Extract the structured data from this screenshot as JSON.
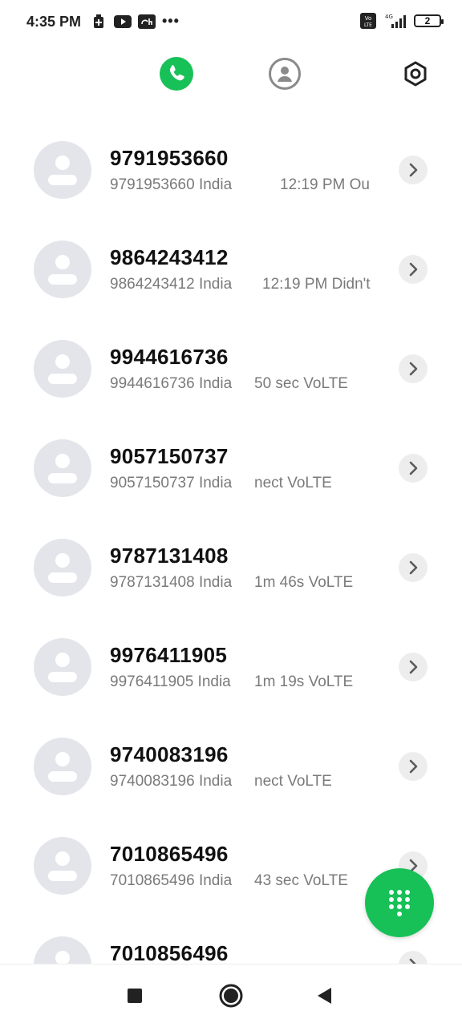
{
  "status_bar": {
    "time": "4:35 PM",
    "left_icons": [
      "battery-saver-icon",
      "youtube-icon",
      "app-icon"
    ],
    "network": "4G",
    "volte": "Vo LTE",
    "battery_level": "2"
  },
  "header": {
    "tabs": [
      {
        "name": "phone-icon",
        "active": true
      },
      {
        "name": "contacts-icon",
        "active": false
      }
    ],
    "settings": "settings-icon"
  },
  "calls": [
    {
      "number": "9791953660",
      "location": "9791953660 India",
      "info": "12:19 PM Ou"
    },
    {
      "number": "9864243412",
      "location": "9864243412 India",
      "info": "12:19 PM Didn't"
    },
    {
      "number": "9944616736",
      "location": "9944616736 India",
      "info": "50 sec VoLTE"
    },
    {
      "number": "9057150737",
      "location": "9057150737 India",
      "info": "nect VoLTE"
    },
    {
      "number": "9787131408",
      "location": "9787131408 India",
      "info": "1m 46s VoLTE"
    },
    {
      "number": "9976411905",
      "location": "9976411905 India",
      "info": "1m 19s VoLTE"
    },
    {
      "number": "9740083196",
      "location": "9740083196 India",
      "info": "nect VoLTE"
    },
    {
      "number": "7010865496",
      "location": "7010865496 India",
      "info": "43 sec VoLTE"
    },
    {
      "number": "7010856496",
      "location": "",
      "info": ""
    }
  ],
  "colors": {
    "accent": "#17c157",
    "avatar_bg": "#e3e5ea",
    "secondary_text": "#7a7a7a"
  },
  "fab": {
    "icon": "dialpad-icon"
  },
  "nav_bar": [
    "recents-icon",
    "home-icon",
    "back-icon"
  ]
}
